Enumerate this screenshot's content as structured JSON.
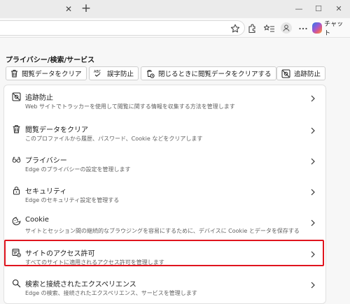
{
  "titlebar": {
    "close_glyph": "✕",
    "newtab_glyph": "+",
    "minimize_glyph": "—",
    "maximize_glyph": "☐"
  },
  "toolbar": {
    "chat_label": "チャット"
  },
  "page": {
    "title": "プライバシー/検索/サービス"
  },
  "quick_actions": [
    {
      "label": "閲覧データをクリア",
      "icon": "trash-icon"
    },
    {
      "label": "誤字防止",
      "icon": "spellcheck-icon"
    },
    {
      "label": "閉じるときに閲覧データをクリアする",
      "icon": "clear-on-close-icon"
    },
    {
      "label": "追跡防止",
      "icon": "tracking-prevention-icon"
    }
  ],
  "settings": [
    {
      "title": "追跡防止",
      "desc": "Web サイトでトラッカーを使用して閲覧に関する情報を収集する方法を管理します",
      "icon": "tracking-prevention-icon"
    },
    {
      "title": "閲覧データをクリア",
      "desc": "このプロファイルから履歴、パスワード、Cookie などをクリアします",
      "icon": "trash-icon"
    },
    {
      "title": "プライバシー",
      "desc": "Edge のプライバシーの設定を管理します",
      "icon": "glasses-icon"
    },
    {
      "title": "セキュリティ",
      "desc": "Edge のセキュリティ設定を管理する",
      "icon": "lock-icon"
    },
    {
      "title": "Cookie",
      "desc": "サイトとセッション間の継続的なブラウジングを容易にするために、デバイスに Cookie とデータを保存する",
      "icon": "cookie-icon"
    },
    {
      "title": "サイトのアクセス許可",
      "desc": "すべてのサイトに適用されるアクセス許可を管理します",
      "icon": "site-permissions-icon"
    },
    {
      "title": "検索と接続されたエクスペリエンス",
      "desc": "Edge の検索、接続されたエクスペリエンス、サービスを管理します",
      "icon": "search-icon"
    }
  ],
  "colors": {
    "highlight": "#e0141e",
    "background": "#f7f7f7"
  }
}
